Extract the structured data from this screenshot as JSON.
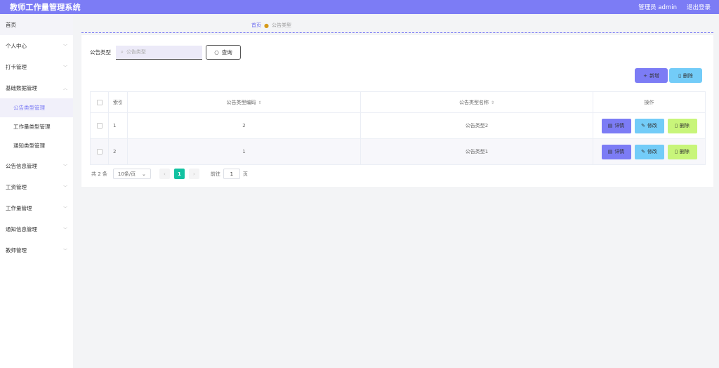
{
  "header": {
    "title": "教师工作量管理系统",
    "user": "管理员 admin",
    "logout": "退出登录"
  },
  "sidebar": {
    "home": "首页",
    "items": [
      {
        "label": "个人中心"
      },
      {
        "label": "打卡管理"
      },
      {
        "label": "基础数据管理",
        "children": [
          "公告类型管理",
          "工作量类型管理",
          "通知类型管理"
        ]
      },
      {
        "label": "公告信息管理"
      },
      {
        "label": "工资管理"
      },
      {
        "label": "工作量管理"
      },
      {
        "label": "通知信息管理"
      },
      {
        "label": "教师管理"
      }
    ]
  },
  "breadcrumb": {
    "home": "首页",
    "current": "公告类型"
  },
  "search": {
    "label": "公告类型",
    "placeholder": "公告类型",
    "button": "查询"
  },
  "actions": {
    "add": "新增",
    "delete": "删除"
  },
  "table": {
    "headers": {
      "index": "索引",
      "code": "公告类型编码",
      "name": "公告类型名称",
      "ops": "操作"
    },
    "rows": [
      {
        "index": "1",
        "code": "2",
        "name": "公告类型2"
      },
      {
        "index": "2",
        "code": "1",
        "name": "公告类型1"
      }
    ],
    "row_ops": {
      "detail": "详情",
      "edit": "修改",
      "delete": "删除"
    }
  },
  "pagination": {
    "total": "共 2 条",
    "page_size": "10条/页",
    "current_page": "1",
    "goto_label": "前往",
    "goto_value": "1",
    "page_suffix": "页"
  },
  "colors": {
    "primary": "#7c7cf5",
    "info": "#73ccf8",
    "success": "#c8f57a",
    "page_active": "#13c2a1"
  }
}
